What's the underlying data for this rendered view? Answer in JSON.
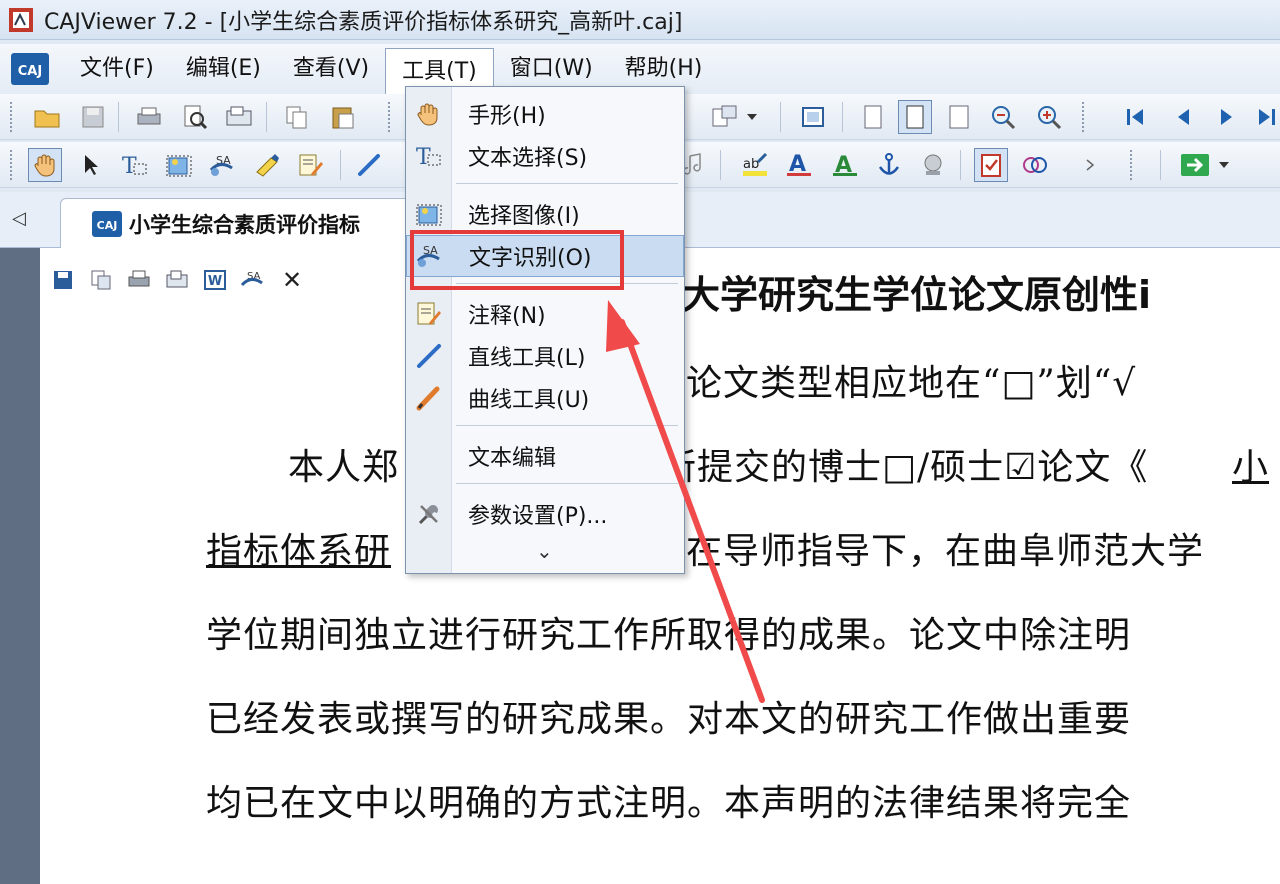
{
  "window": {
    "title": "CAJViewer 7.2 - [小学生综合素质评价指标体系研究_高新叶.caj]"
  },
  "menubar": {
    "items": [
      "文件(F)",
      "编辑(E)",
      "查看(V)",
      "工具(T)",
      "窗口(W)",
      "帮助(H)"
    ],
    "active": "工具(T)"
  },
  "tabs": {
    "document_tab": "小学生综合素质评价指标"
  },
  "tools_menu": {
    "items": [
      {
        "label": "手形(H)",
        "icon": "hand-icon"
      },
      {
        "label": "文本选择(S)",
        "icon": "text-select-icon"
      },
      {
        "label": "选择图像(I)",
        "icon": "image-select-icon"
      },
      {
        "label": "文字识别(O)",
        "icon": "ocr-icon",
        "highlighted": true
      },
      {
        "label": "注释(N)",
        "icon": "annotate-icon"
      },
      {
        "label": "直线工具(L)",
        "icon": "line-tool-icon"
      },
      {
        "label": "曲线工具(U)",
        "icon": "curve-tool-icon"
      },
      {
        "label": "文本编辑",
        "icon": "none"
      },
      {
        "label": "参数设置(P)...",
        "icon": "settings-tools-icon"
      }
    ],
    "more_indicator": "⌄"
  },
  "document": {
    "heading": "大学研究生学位论文原创性i",
    "lines": [
      "论文类型相应地在“□”划“√",
      "本人郑",
      "所提交的博士□/硕士☑论文《",
      "小",
      "指标体系研",
      "在导师指导下，在曲阜师范大学",
      "学位期间独立进行研究工作所取得的成果。论文中除注明",
      "已经发表或撰写的研究成果。对本文的研究工作做出重要",
      "均已在文中以明确的方式注明。本声明的法律结果将完全"
    ]
  },
  "annotation": {
    "box_color": "#e53a3a",
    "arrow_color": "#f04a4a"
  }
}
